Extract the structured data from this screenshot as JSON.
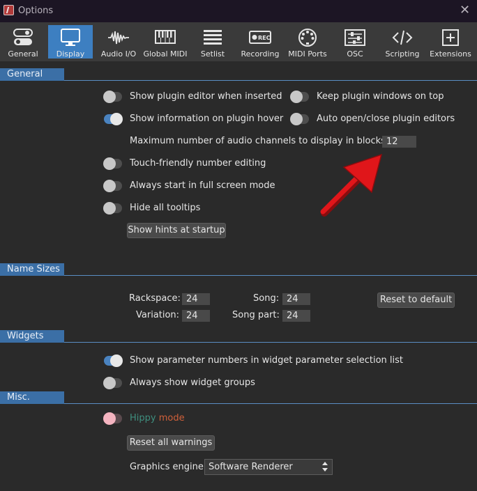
{
  "window": {
    "title": "Options",
    "close_glyph": "✕"
  },
  "tabs": [
    {
      "label": "General",
      "icon": "toggles-icon"
    },
    {
      "label": "Display",
      "icon": "monitor-icon"
    },
    {
      "label": "Audio I/O",
      "icon": "waveform-icon"
    },
    {
      "label": "Global MIDI",
      "icon": "keyboard-icon"
    },
    {
      "label": "Setlist",
      "icon": "list-icon"
    },
    {
      "label": "Recording",
      "icon": "rec-icon"
    },
    {
      "label": "MIDI Ports",
      "icon": "midi-port-icon"
    },
    {
      "label": "OSC",
      "icon": "sliders-icon"
    },
    {
      "label": "Scripting",
      "icon": "code-icon"
    },
    {
      "label": "Extensions",
      "icon": "plus-box-icon"
    }
  ],
  "active_tab": "Display",
  "rec_icon_text": "REC",
  "sections": {
    "general": "General",
    "name_sizes": "Name Sizes",
    "widgets": "Widgets",
    "misc": "Misc."
  },
  "general": {
    "show_plugin_editor": {
      "label": "Show plugin editor when inserted",
      "on": false
    },
    "keep_plugin_windows": {
      "label": "Keep plugin windows on top",
      "on": false
    },
    "show_info_hover": {
      "label": "Show information on plugin hover",
      "on": true
    },
    "auto_open_close": {
      "label": "Auto open/close plugin editors",
      "on": false
    },
    "max_channels_label": "Maximum number of audio channels to display in blocks",
    "max_channels_value": "12",
    "touch_friendly": {
      "label": "Touch-friendly number editing",
      "on": false
    },
    "full_screen": {
      "label": "Always start in full screen mode",
      "on": false
    },
    "hide_tooltips": {
      "label": "Hide all tooltips",
      "on": false
    },
    "show_hints_button": "Show hints at startup"
  },
  "name_sizes": {
    "rackspace_label": "Rackspace:",
    "rackspace_value": "24",
    "song_label": "Song:",
    "song_value": "24",
    "variation_label": "Variation:",
    "variation_value": "24",
    "song_part_label": "Song part:",
    "song_part_value": "24",
    "reset_button": "Reset to default"
  },
  "widgets": {
    "show_param_numbers": {
      "label": "Show parameter numbers in widget parameter selection list",
      "on": true
    },
    "always_show_groups": {
      "label": "Always show widget groups",
      "on": false
    }
  },
  "misc": {
    "hippy_word1": "Hippy",
    "hippy_word2": "mode",
    "reset_warnings_button": "Reset all warnings",
    "graphics_engine_label": "Graphics engine",
    "graphics_engine_value": "Software Renderer"
  },
  "colors": {
    "accent": "#3d7fc1",
    "section": "#3b6fa6",
    "annotation_arrow": "#e0161a",
    "hippy1": "#3f8f7f",
    "hippy2": "#d0603a"
  }
}
